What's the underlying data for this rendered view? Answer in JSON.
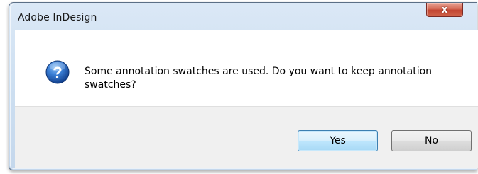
{
  "dialog": {
    "title": "Adobe InDesign",
    "close_label": "x",
    "icon": "question-icon",
    "message": "Some annotation swatches are used. Do you want to keep annotation swatches?",
    "buttons": {
      "yes": "Yes",
      "no": "No"
    }
  },
  "colors": {
    "accent": "#3c7fb1",
    "close_button": "#c24531",
    "question_icon": "#2a63b8"
  }
}
